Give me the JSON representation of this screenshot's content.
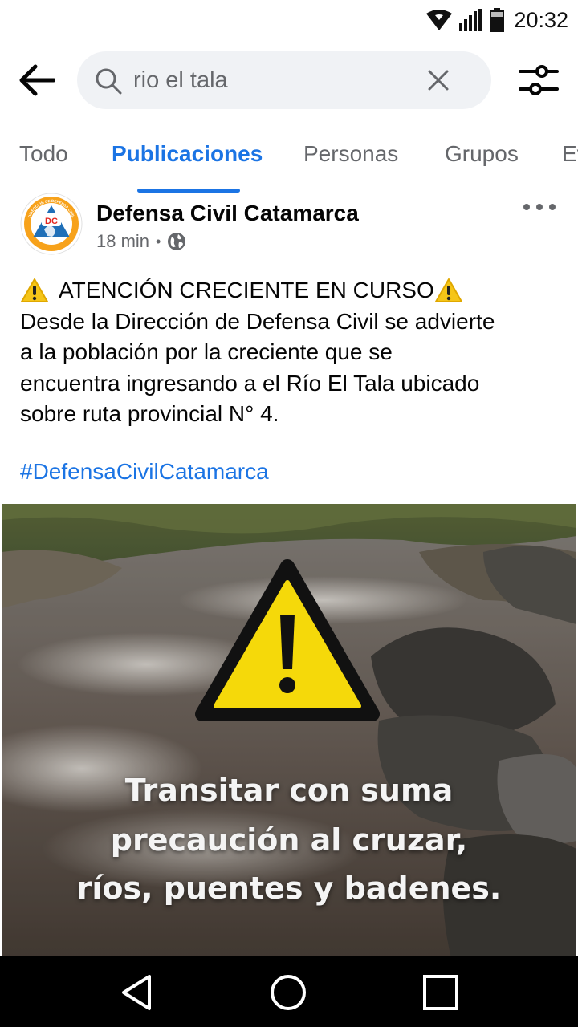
{
  "status_bar": {
    "time": "20:32",
    "icons": [
      "wifi-icon",
      "signal-icon",
      "battery-icon"
    ]
  },
  "search": {
    "query": "rio el tala",
    "icons": {
      "back": "arrow-left-icon",
      "search": "search-icon",
      "clear": "close-icon",
      "filter": "filter-sliders-icon"
    }
  },
  "tabs": [
    {
      "label": "Todo",
      "active": false
    },
    {
      "label": "Publicaciones",
      "active": true
    },
    {
      "label": "Personas",
      "active": false
    },
    {
      "label": "Grupos",
      "active": false
    },
    {
      "label": "Ev",
      "active": false
    }
  ],
  "post": {
    "author": "Defensa Civil Catamarca",
    "avatar": {
      "initials": "DC",
      "ring_text_top": "DIRECCIÓN DE DEFENSA CIVIL",
      "ring_text_bottom": "CATAMARCA"
    },
    "time": "18 min",
    "audience_icon": "globe-icon",
    "more_icon": "more-horizontal-icon",
    "text": {
      "headline": "ATENCIÓN CRECIENTE EN CURSO",
      "lines": [
        "Desde la Dirección de Defensa Civil se advierte",
        "a la población por la creciente que se",
        "encuentra ingresando a el Río El Tala ubicado",
        "sobre ruta provincial N° 4."
      ]
    },
    "hashtag": "#DefensaCivilCatamarca",
    "image": {
      "caption_lines": [
        "Transitar con suma",
        "precaución al cruzar,",
        "ríos, puentes y badenes."
      ],
      "icon": "warning-triangle-icon"
    }
  },
  "nav_bar": {
    "icons": [
      "back-triangle-icon",
      "home-circle-icon",
      "recents-square-icon"
    ]
  },
  "colors": {
    "accent": "#1b74e4",
    "muted_text": "#65676b",
    "search_bg": "#f0f2f5",
    "warning_yellow": "#f5d90a"
  }
}
